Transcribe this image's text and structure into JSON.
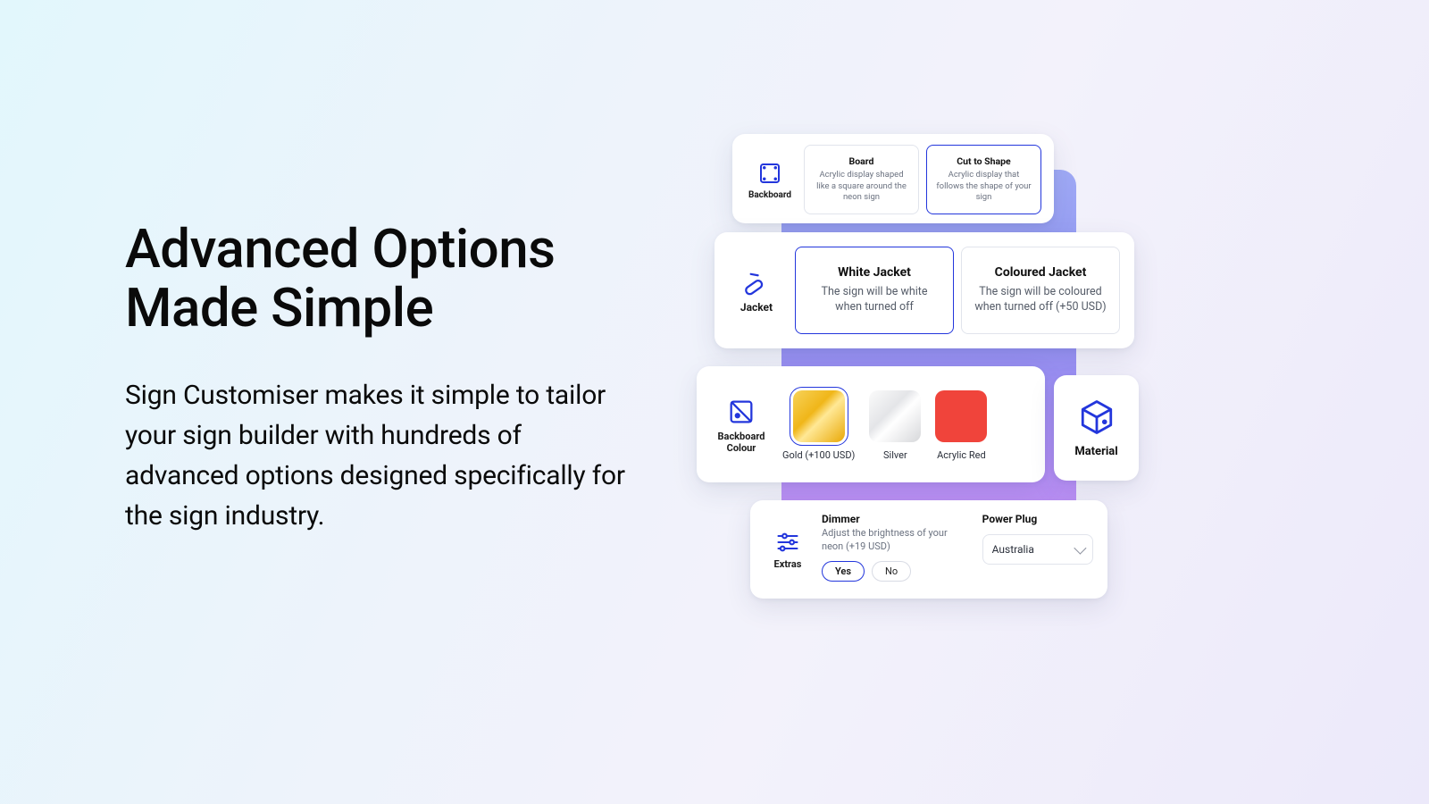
{
  "hero": {
    "title_line1": "Advanced Options",
    "title_line2": "Made Simple",
    "body": "Sign Customiser makes it simple to tailor your sign builder with hundreds of advanced options designed specifically for the sign industry."
  },
  "backboard": {
    "label": "Backboard",
    "options": [
      {
        "title": "Board",
        "desc": "Acrylic display shaped like a square around the neon sign",
        "selected": false
      },
      {
        "title": "Cut to Shape",
        "desc": "Acrylic display that follows the shape of your sign",
        "selected": true
      }
    ]
  },
  "jacket": {
    "label": "Jacket",
    "options": [
      {
        "title": "White Jacket",
        "desc": "The sign will be white when turned off",
        "selected": true
      },
      {
        "title": "Coloured Jacket",
        "desc": "The sign will be coloured when turned off (+50 USD)",
        "selected": false
      }
    ]
  },
  "colour": {
    "label_line1": "Backboard",
    "label_line2": "Colour",
    "swatches": [
      {
        "name": "Gold (+100 USD)",
        "key": "gold",
        "selected": true
      },
      {
        "name": "Silver",
        "key": "silver",
        "selected": false
      },
      {
        "name": "Acrylic Red",
        "key": "red",
        "selected": false
      }
    ]
  },
  "material": {
    "label": "Material"
  },
  "extras": {
    "label": "Extras",
    "dimmer": {
      "title": "Dimmer",
      "desc": "Adjust the brightness of your neon (+19 USD)",
      "yes": "Yes",
      "no": "No",
      "selected": "Yes"
    },
    "plug": {
      "title": "Power Plug",
      "value": "Australia"
    }
  }
}
